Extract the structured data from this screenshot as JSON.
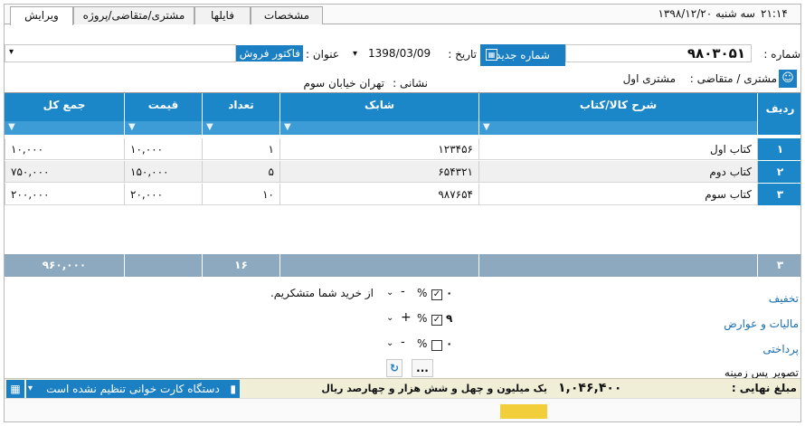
{
  "topbar": {
    "clock": "۲۱:۱۴",
    "date_day": "سه شنبه ۱۳۹۸/۱۲/۲۰",
    "tabs": [
      "ویرایش",
      "مشتری/متقاضی/پروژه",
      "فایلها",
      "مشخصات"
    ]
  },
  "header": {
    "number_label": "شماره :",
    "number_value": "۹۸۰۳۰۵۱",
    "new_number_button": "شماره جدید",
    "date_label": "تاریخ :",
    "date_value": "1398/03/09",
    "title_label": "عنوان :",
    "title_value": "فاکتور فروش",
    "customer_label": "مشتری / متقاضی :",
    "customer_value": "مشتری اول",
    "address_label": "نشانی :",
    "address_value": "تهران خیابان سوم"
  },
  "grid": {
    "columns": [
      "ردیف",
      "شرح کالا/کتاب",
      "شابک",
      "تعداد",
      "قیمت",
      "جمع کل"
    ],
    "rows": [
      {
        "rn": "۱",
        "desc": "کتاب اول",
        "isbn": "۱۲۳۴۵۶",
        "qty": "۱",
        "price": "۱۰,۰۰۰",
        "total": "۱۰,۰۰۰"
      },
      {
        "rn": "۲",
        "desc": "کتاب دوم",
        "isbn": "۶۵۴۳۲۱",
        "qty": "۵",
        "price": "۱۵۰,۰۰۰",
        "total": "۷۵۰,۰۰۰"
      },
      {
        "rn": "۳",
        "desc": "کتاب سوم",
        "isbn": "۹۸۷۶۵۴",
        "qty": "۱۰",
        "price": "۲۰,۰۰۰",
        "total": "۲۰۰,۰۰۰"
      }
    ],
    "totals": {
      "rn": "۳",
      "qty": "۱۶",
      "total": "۹۶۰,۰۰۰"
    }
  },
  "adjustments": {
    "discount_label": "تخفیف",
    "discount_value": "۰",
    "tax_label": "مالیات و عوارض",
    "tax_value": "۹",
    "payment_label": "پرداختی",
    "payment_value": "۰",
    "percent": "%",
    "minus": "-",
    "plus": "+",
    "more": "...",
    "background_label": "تصویر پس زمینه",
    "note": "از خرید شما متشکریم."
  },
  "status": {
    "final_label": "مبلغ نهایی :",
    "final_value": "۱,۰۴۶,۴۰۰",
    "final_words": "یک میلیون و چهل و شش هزار و چهارصد ریال",
    "card_reader": "دستگاه کارت خوانی تنظیم نشده است"
  },
  "colors": {
    "accent": "#1b87c9",
    "totals_row": "#8da9bf"
  }
}
